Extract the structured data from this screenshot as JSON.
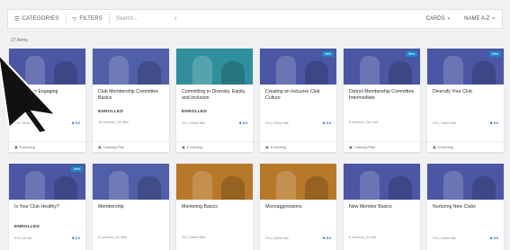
{
  "toolbar": {
    "categories_label": "CATEGORIES",
    "filters_label": "FILTERS",
    "search_placeholder": "Search...",
    "view_label": "CARDS",
    "sort_label": "NAME A-Z"
  },
  "item_count": "27 items",
  "colors": {
    "accent": "#1e88c7",
    "star": "#2a65b8"
  },
  "rows": [
    [
      {
        "title": "...ctices for Engaging",
        "badge": "",
        "enrolled": "ENROLLED",
        "meta": "0% | 9min title",
        "rating": "5.0",
        "footer": "E-learning",
        "thumb": "#4b57a4"
      },
      {
        "title": "Club Membership Committee Basics",
        "badge": "",
        "enrolled": "ENROLLED",
        "meta": "16 courses | 3h 48m",
        "rating": "",
        "footer": "Learning Plan",
        "thumb": "#4f5fa8"
      },
      {
        "title": "Committing to Diversity, Equity, and Inclusion",
        "badge": "",
        "enrolled": "ENROLLED",
        "meta": "0% | 10min title",
        "rating": "5.0",
        "footer": "E-learning",
        "thumb": "#2f8f9c"
      },
      {
        "title": "Creating an Inclusive Club Culture",
        "badge": "New",
        "enrolled": "",
        "meta": "0% | 15min title",
        "rating": "5.0",
        "footer": "E-learning",
        "thumb": "#4b57a4"
      },
      {
        "title": "District Membership Committee Intermediate",
        "badge": "New",
        "enrolled": "",
        "meta": "6 courses | 3h 14m",
        "rating": "",
        "footer": "Learning Plan",
        "thumb": "#4b57a4"
      },
      {
        "title": "Diversify Your Club",
        "badge": "New",
        "enrolled": "",
        "meta": "0% | 18min title",
        "rating": "5.0",
        "footer": "E-learning",
        "thumb": "#4b57a4"
      }
    ],
    [
      {
        "title": "Is Your Club Healthy?",
        "badge": "New",
        "enrolled": "ENROLLED",
        "meta": "0% | 15 min",
        "rating": "5.0",
        "footer": "",
        "thumb": "#4b57a4"
      },
      {
        "title": "Membership",
        "badge": "",
        "enrolled": "",
        "meta": "8 courses | 4h 48m",
        "rating": "",
        "footer": "",
        "thumb": "#4f5fa8"
      },
      {
        "title": "Mentoring Basics",
        "badge": "",
        "enrolled": "",
        "meta": "0% | 20min title",
        "rating": "",
        "footer": "",
        "thumb": "#b8782a"
      },
      {
        "title": "Microaggressions",
        "badge": "",
        "enrolled": "",
        "meta": "0% | 15min title",
        "rating": "5.0",
        "footer": "",
        "thumb": "#b8782a"
      },
      {
        "title": "New Member Basics",
        "badge": "",
        "enrolled": "",
        "meta": "6 courses | 1h 8m",
        "rating": "",
        "footer": "",
        "thumb": "#4b57a4"
      },
      {
        "title": "Nurturing New Clubs",
        "badge": "",
        "enrolled": "",
        "meta": "0% | 10min title",
        "rating": "5.0",
        "footer": "",
        "thumb": "#4b57a4"
      }
    ]
  ]
}
